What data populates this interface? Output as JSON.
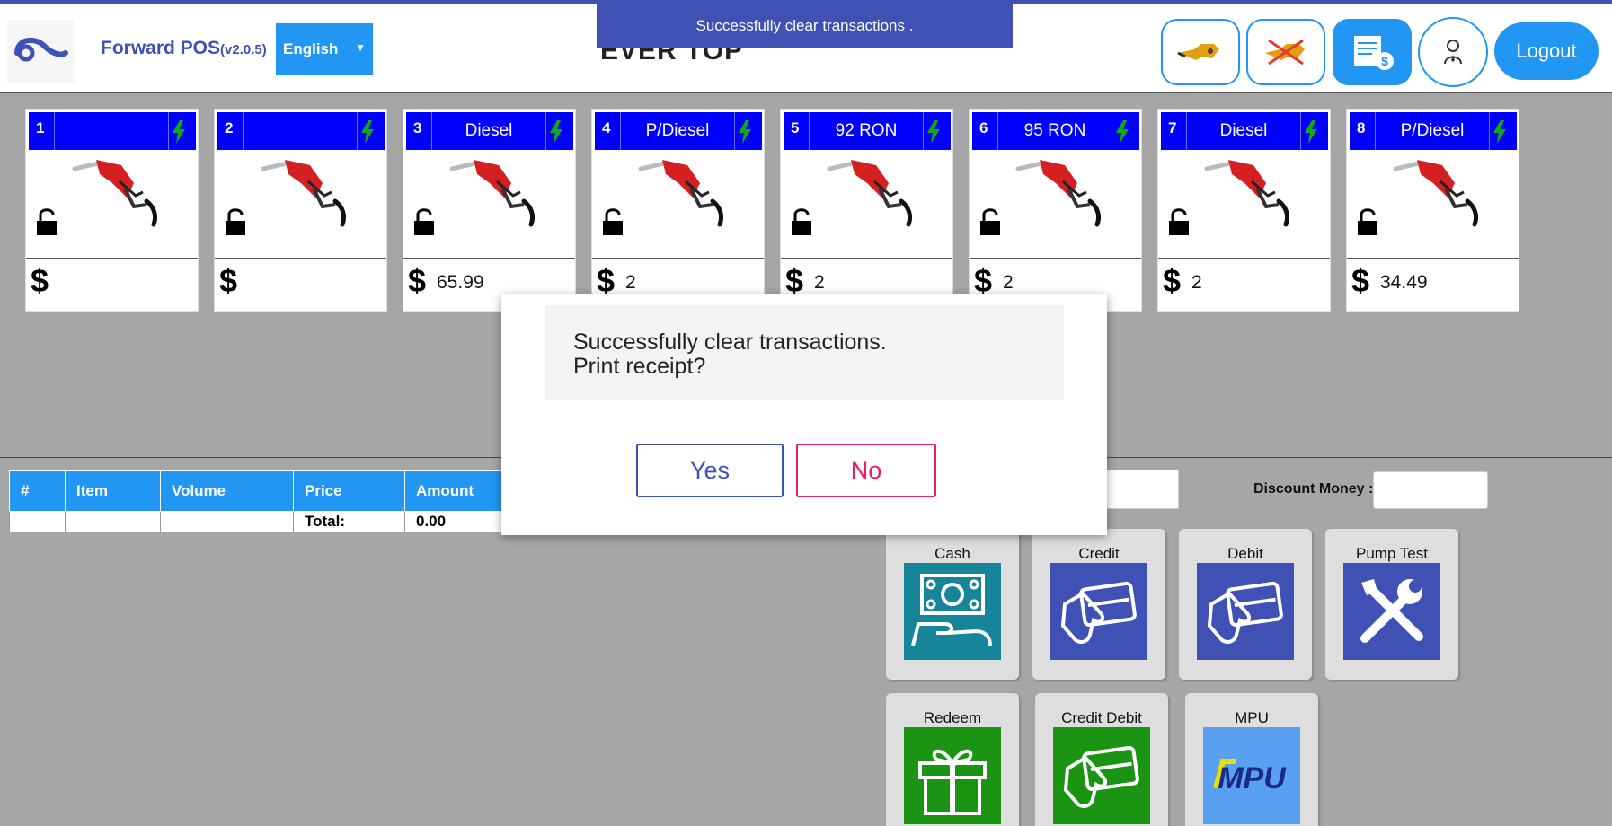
{
  "header": {
    "app_name": "Forward POS",
    "version": "(v2.0.5)",
    "language": "English",
    "station_name": "EVER TOP",
    "logout_label": "Logout",
    "icon_buttons": [
      "nozzle-icon",
      "nozzle-disabled-icon",
      "invoice-money-icon",
      "user-icon"
    ]
  },
  "toast": {
    "message": "Successfully clear transactions ."
  },
  "pumps": [
    {
      "number": "1",
      "fuel": "",
      "amount": ""
    },
    {
      "number": "2",
      "fuel": "",
      "amount": ""
    },
    {
      "number": "3",
      "fuel": "Diesel",
      "amount": "65.99"
    },
    {
      "number": "4",
      "fuel": "P/Diesel",
      "amount": "2"
    },
    {
      "number": "5",
      "fuel": "92 RON",
      "amount": "2"
    },
    {
      "number": "6",
      "fuel": "95 RON",
      "amount": "2"
    },
    {
      "number": "7",
      "fuel": "Diesel",
      "amount": "2"
    },
    {
      "number": "8",
      "fuel": "P/Diesel",
      "amount": "34.49"
    }
  ],
  "pump_currency": "$",
  "table": {
    "headers": [
      "#",
      "Item",
      "Volume",
      "Price",
      "Amount"
    ],
    "total_label": "Total:",
    "total_value": "0.00"
  },
  "discount": {
    "label": "Discount Money :"
  },
  "payment_methods": [
    {
      "label": "Cash",
      "icon": "cash-icon",
      "color": "#16859a"
    },
    {
      "label": "Credit",
      "icon": "credit-card-icon",
      "color": "#3f51b5"
    },
    {
      "label": "Debit",
      "icon": "debit-card-icon",
      "color": "#3f51b5"
    },
    {
      "label": "Pump Test",
      "icon": "tools-icon",
      "color": "#3f51b5"
    },
    {
      "label": "Redeem",
      "icon": "gift-icon",
      "color": "#1a9412"
    },
    {
      "label": "Credit Debit",
      "icon": "credit-debit-icon",
      "color": "#1a9412"
    },
    {
      "label": "MPU",
      "icon": "mpu-logo-icon",
      "color": "#5aa0f0"
    }
  ],
  "dialog": {
    "line1": "Successfully clear transactions.",
    "line2": "Print receipt?",
    "yes_label": "Yes",
    "no_label": "No"
  },
  "colors": {
    "primary": "#2196f3",
    "indigo": "#3f51b5",
    "pump_header": "#0000ff",
    "bolt": "#11aa11",
    "no_button": "#e91e63"
  }
}
